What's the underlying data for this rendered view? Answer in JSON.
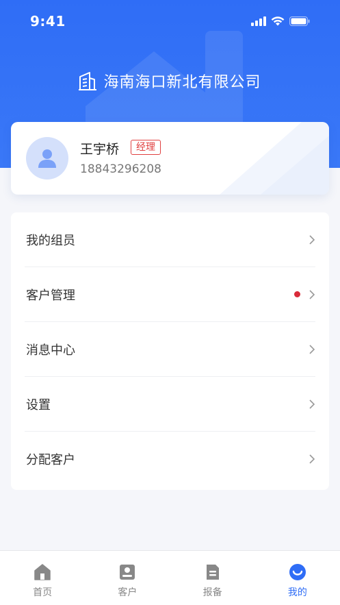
{
  "status_bar": {
    "time": "9:41"
  },
  "header": {
    "company_name": "海南海口新北有限公司"
  },
  "profile": {
    "name": "王宇桥",
    "role": "经理",
    "phone": "18843296208"
  },
  "menu": {
    "items": [
      {
        "label": "我的组员",
        "has_dot": false
      },
      {
        "label": "客户管理",
        "has_dot": true
      },
      {
        "label": "消息中心",
        "has_dot": false
      },
      {
        "label": "设置",
        "has_dot": false
      },
      {
        "label": "分配客户",
        "has_dot": false
      }
    ]
  },
  "tabbar": {
    "tabs": [
      {
        "label": "首页",
        "icon": "home-icon",
        "active": false
      },
      {
        "label": "客户",
        "icon": "customer-icon",
        "active": false
      },
      {
        "label": "报备",
        "icon": "report-icon",
        "active": false
      },
      {
        "label": "我的",
        "icon": "smile-icon",
        "active": true
      }
    ]
  },
  "colors": {
    "primary": "#2f6df6",
    "badge_red": "#e04040",
    "dot_red": "#d92b3a",
    "inactive_tab": "#888888"
  }
}
